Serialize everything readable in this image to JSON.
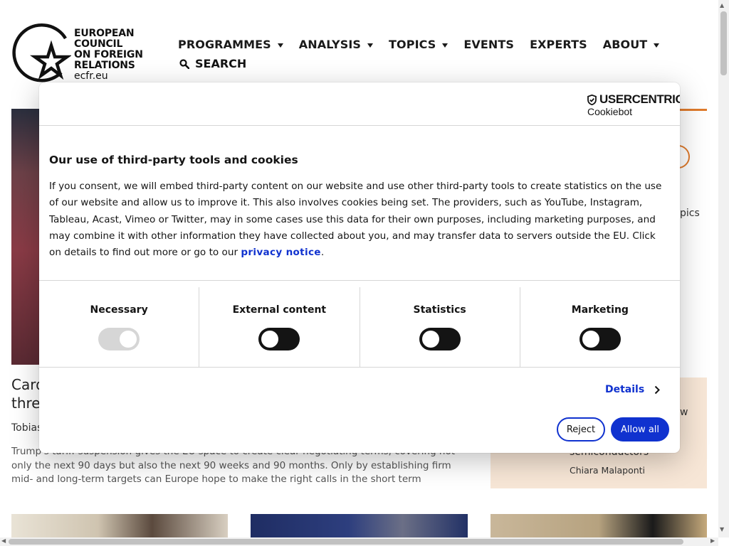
{
  "site": {
    "logo_text": "EUROPEAN\nCOUNCIL\nON FOREIGN\nRELATIONS",
    "logo_url": "ecfr.eu",
    "nav": [
      {
        "label": "PROGRAMMES",
        "dropdown": true
      },
      {
        "label": "ANALYSIS",
        "dropdown": true
      },
      {
        "label": "TOPICS",
        "dropdown": true
      },
      {
        "label": "EVENTS",
        "dropdown": false
      },
      {
        "label": "EXPERTS",
        "dropdown": false
      },
      {
        "label": "ABOUT",
        "dropdown": true
      }
    ],
    "search_label": "SEARCH",
    "topics_fragment": "pics",
    "article": {
      "headline": "Card                                                                                          thre",
      "headline_line1": "Card",
      "headline_line2": "thre",
      "byline": "Tobias",
      "summary": "Trump's tariff suspension gives the EU space to create clear negotiating terms, covering not only the next 90 days but also the next 90 weeks and 90 months. Only by establishing firm mid- and long-term targets can Europe hope to make the right calls in the short term"
    },
    "side_card": {
      "fragment": "w",
      "title": "semiconductors",
      "author": "Chiara Malaponti"
    },
    "accent_color": "#e07b2c"
  },
  "cookie_dialog": {
    "brand_name": "USERCENTRICS",
    "brand_sub": "Cookiebot",
    "title": "Our use of third-party tools and cookies",
    "text_before_link": "If you consent, we will embed third-party content on our website and use other third-party tools to create statistics on the use of our website and allow us to improve it. This also involves cookies being set. The providers, such as YouTube, Instagram, Tableau, Acast, Vimeo  or Twitter, may in some cases use this data for their own purposes, including marketing purposes, and may combine it with other information they have collected about you, and may transfer data to servers outside the EU. Click on details to find out more or go to our ",
    "link_text": "privacy notice",
    "text_after_link": ".",
    "categories": [
      {
        "label": "Necessary",
        "enabled": true,
        "locked": true
      },
      {
        "label": "External content",
        "enabled": false,
        "locked": false
      },
      {
        "label": "Statistics",
        "enabled": false,
        "locked": false
      },
      {
        "label": "Marketing",
        "enabled": false,
        "locked": false
      }
    ],
    "details_label": "Details",
    "reject_label": "Reject",
    "allow_all_label": "Allow all",
    "primary_color": "#1032cf"
  }
}
